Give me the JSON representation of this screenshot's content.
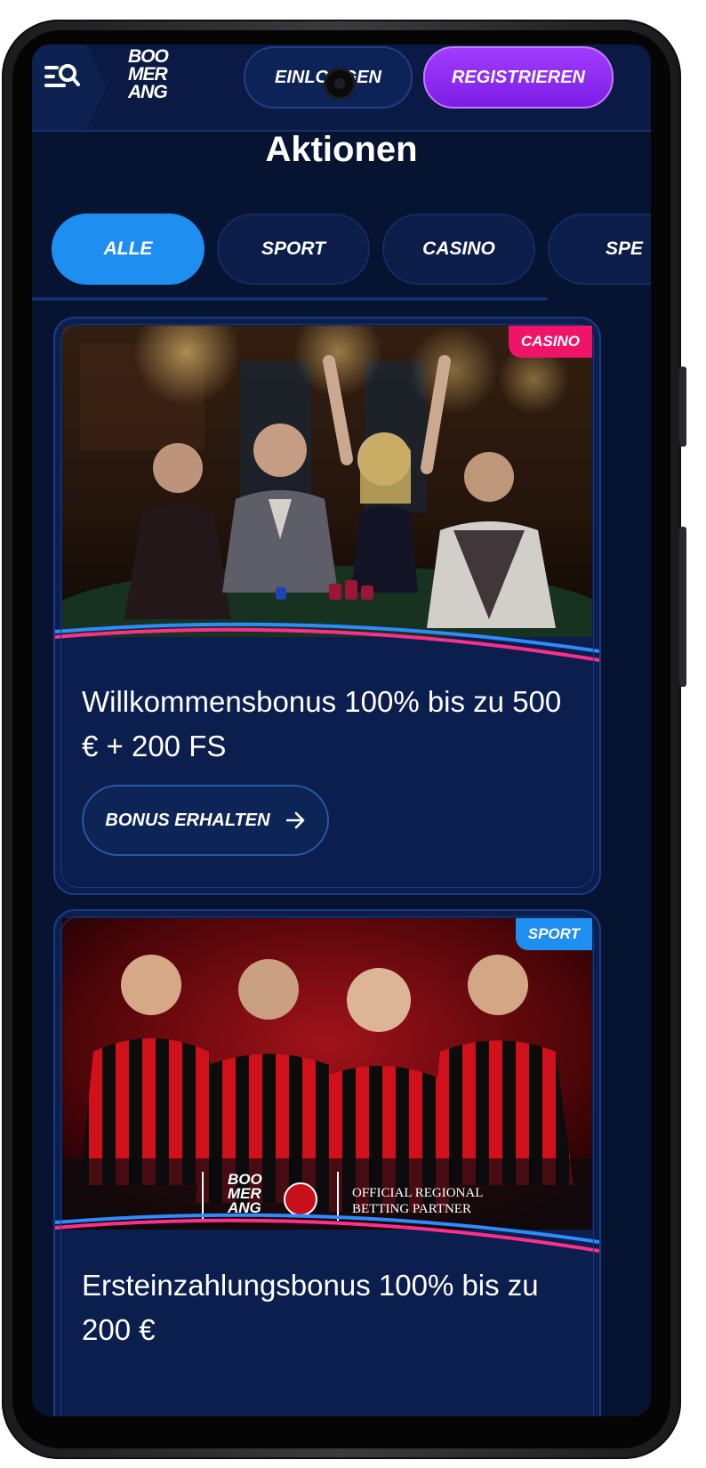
{
  "header": {
    "logo_lines": [
      "BOO",
      "MER",
      "ANG"
    ],
    "login_label": "EINLOGGEN",
    "register_label": "REGISTRIEREN"
  },
  "page": {
    "title": "Aktionen"
  },
  "tabs": [
    {
      "label": "ALLE",
      "active": true
    },
    {
      "label": "SPORT",
      "active": false
    },
    {
      "label": "CASINO",
      "active": false
    },
    {
      "label": "SPE",
      "active": false
    }
  ],
  "promotions": [
    {
      "badge": "CASINO",
      "title": "Willkommensbonus 100% bis zu 500 € + 200 FS",
      "cta_label": "BONUS ERHALTEN",
      "image": "casino-table-players"
    },
    {
      "badge": "SPORT",
      "title": "Ersteinzahlungsbonus 100% bis zu 200 €",
      "image": "ac-milan-players",
      "partner_logo_lines": [
        "BOO",
        "MER",
        "ANG"
      ],
      "partner_text_1": "OFFICIAL REGIONAL",
      "partner_text_2": "BETTING PARTNER"
    }
  ],
  "colors": {
    "background": "#071431",
    "accent_blue": "#1e8ff0",
    "register_purple": "#8a2cf0",
    "casino_pink": "#ef1467"
  },
  "icons": {
    "menu": "menu-search-icon",
    "arrow": "arrow-right-icon"
  }
}
